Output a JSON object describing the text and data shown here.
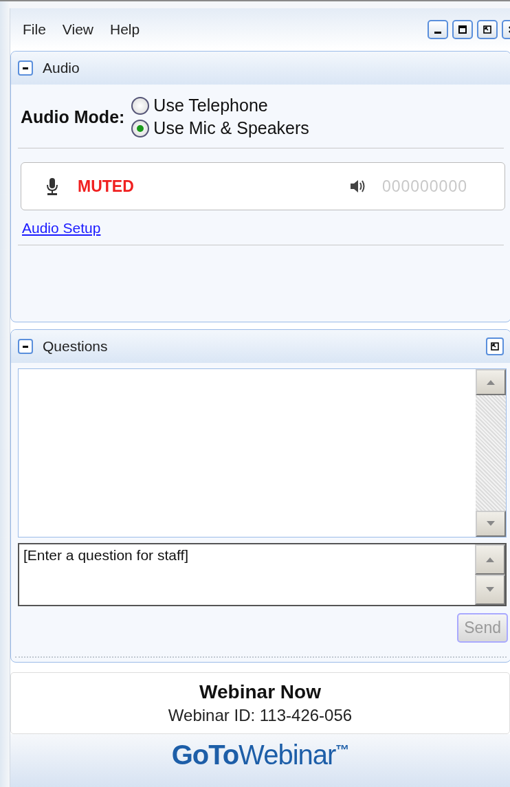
{
  "menu": [
    {
      "label": "File"
    },
    {
      "label": "View"
    },
    {
      "label": "Help"
    }
  ],
  "window_controls": [
    {
      "kind": "minimize"
    },
    {
      "kind": "maximize"
    },
    {
      "kind": "restore"
    },
    {
      "kind": "close"
    }
  ],
  "audio": {
    "title": "Audio",
    "expanded": true,
    "mode_label": "Audio Mode:",
    "modes": [
      {
        "label": "Use Telephone",
        "selected": false
      },
      {
        "label": "Use Mic & Speakers",
        "selected": true
      }
    ],
    "mic_status": "MUTED",
    "muted": true,
    "speaker_meter": "000000000",
    "setup_link": "Audio Setup"
  },
  "questions": {
    "title": "Questions",
    "expanded": true,
    "input": {
      "placeholder": "[Enter a question for staff]"
    },
    "send": {
      "label": "Send",
      "disabled": true
    }
  },
  "footer": {
    "title": "Webinar Now",
    "webinar_id": "Webinar ID: 113-426-056",
    "logo": "**GoTo**Webinar$^{™}$"
  }
}
